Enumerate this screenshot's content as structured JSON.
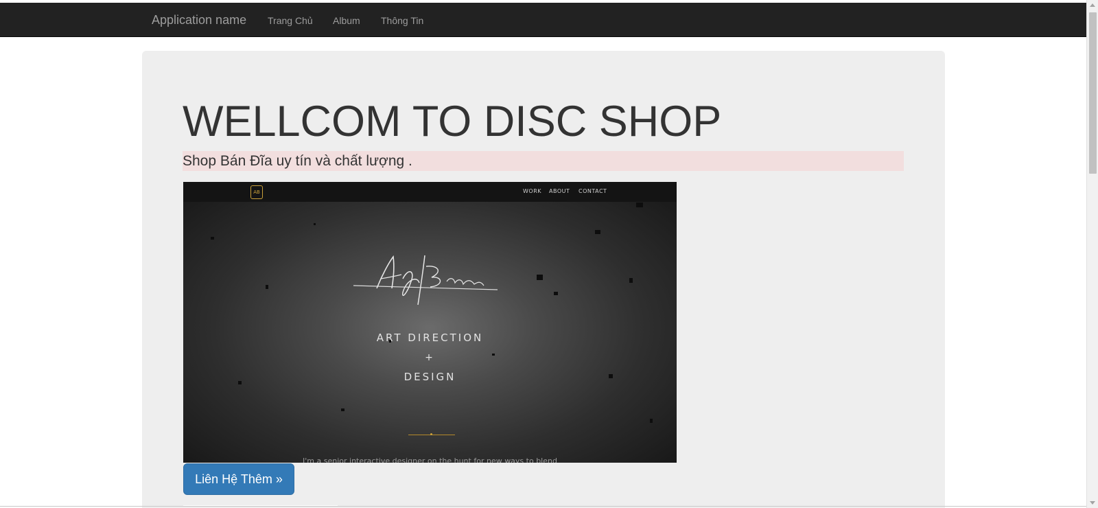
{
  "navbar": {
    "brand": "Application name",
    "items": [
      {
        "label": "Trang Chủ"
      },
      {
        "label": "Album"
      },
      {
        "label": "Thông Tin"
      }
    ],
    "background": "#222222",
    "text_color": "#9d9d9d"
  },
  "jumbotron": {
    "headline": "WELLCOM TO DISC SHOP",
    "subtitle": "Shop Bán Đĩa uy tín và chất lượng .",
    "subtitle_highlight": "#f2dede",
    "background": "#eeeeee"
  },
  "hero_image": {
    "logo": "AB",
    "links": [
      "WORK",
      "ABOUT",
      "CONTACT"
    ],
    "line1": "ART DIRECTION",
    "plus": "+",
    "line2": "DESIGN",
    "caption": "I'm a senior interactive designer on the hunt for new ways to blend"
  },
  "cta_button": {
    "label": "Liên Hệ Thêm »",
    "color": "#337ab7"
  },
  "icons": {
    "scroll_up": "chevron-up-icon",
    "scroll_down": "chevron-down-icon"
  }
}
